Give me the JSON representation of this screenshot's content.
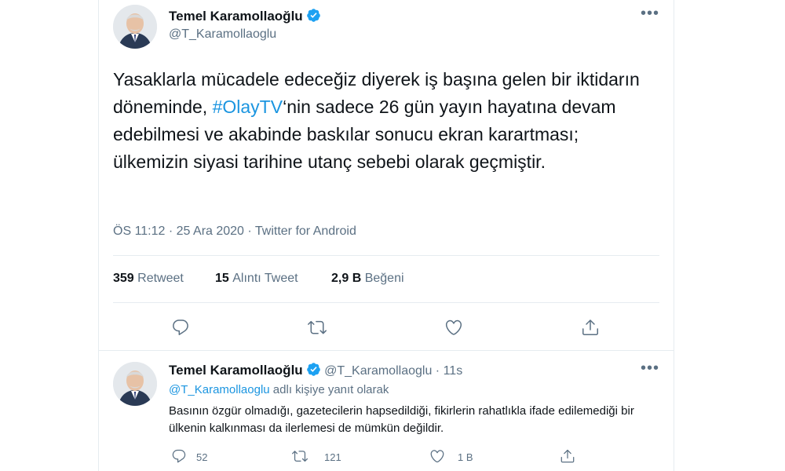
{
  "main_tweet": {
    "author_name": "Temel Karamollaoğlu",
    "author_handle": "@T_Karamollaoglu",
    "more": "•••",
    "text_part1": "Yasaklarla mücadele edeceğiz diyerek iş başına gelen bir iktidarın döneminde, ",
    "hashtag": "#OlayTV",
    "text_part2": "‘nin sadece 26 gün yayın hayatına devam edebilmesi ve akabinde baskılar sonucu ekran karartması; ülkemizin siyasi tarihine utanç sebebi olarak geçmiştir.",
    "time": "ÖS 11:12",
    "sep1": "·",
    "date": "25 Ara 2020",
    "sep2": "·",
    "source": "Twitter for Android",
    "stats": {
      "retweet_count": "359",
      "retweet_label": "Retweet",
      "quote_count": "15",
      "quote_label": "Alıntı Tweet",
      "like_count": "2,9 B",
      "like_label": "Beğeni"
    }
  },
  "reply_tweet": {
    "author_name": "Temel Karamollaoğlu",
    "author_handle": "@T_Karamollaoglu",
    "sep": "·",
    "time_ago": "11s",
    "more": "•••",
    "reply_to_handle": "@T_Karamollaoglu",
    "reply_to_suffix": "adlı kişiye yanıt olarak",
    "text": "Basının özgür olmadığı, gazetecilerin hapsedildiği, fikirlerin rahatlıkla ifade edilemediği bir ülkenin kalkınması da ilerlemesi de mümkün değildir.",
    "reply_count": "52",
    "retweet_count": "121",
    "like_count": "1 B"
  },
  "colors": {
    "text": "#0f1419",
    "secondary": "#5b7083",
    "link": "#1b95e0",
    "verified": "#1da1f2",
    "divider": "#e6ecf0"
  },
  "icons": {
    "verified": "verified-badge-icon",
    "reply": "reply-icon",
    "retweet": "retweet-icon",
    "like": "like-icon",
    "share": "share-icon",
    "more": "more-icon"
  }
}
